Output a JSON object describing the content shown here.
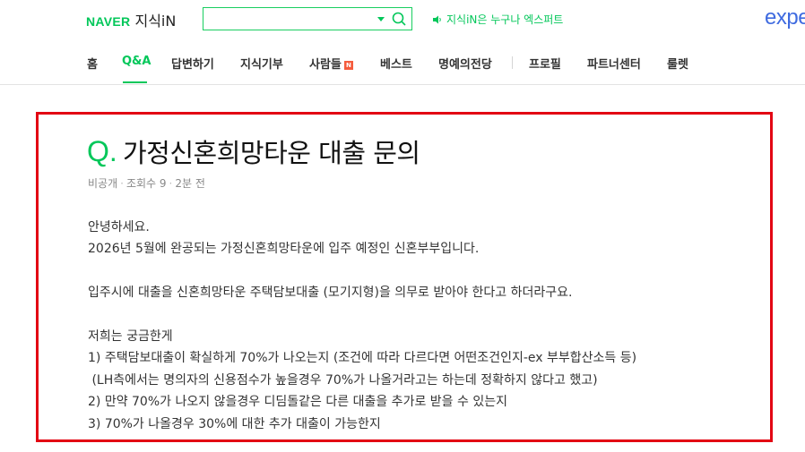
{
  "header": {
    "brand": "NAVER",
    "service": "지식iN",
    "search_value": "",
    "promo_text": "지식iN은 누구나 엑스퍼트",
    "expert_logo_text": "expe"
  },
  "nav": {
    "items": [
      {
        "label": "홈"
      },
      {
        "label": "Q&A"
      },
      {
        "label": "답변하기"
      },
      {
        "label": "지식기부"
      },
      {
        "label": "사람들"
      },
      {
        "label": "베스트"
      },
      {
        "label": "명예의전당"
      },
      {
        "label": "프로필"
      },
      {
        "label": "파트너센터"
      },
      {
        "label": "룰렛"
      }
    ],
    "active_index": 1,
    "badge_new": "N"
  },
  "question": {
    "q_mark": "Q.",
    "title": "가정신혼희망타운 대출 문의",
    "meta": {
      "author": "비공개",
      "views": "조회수 9",
      "time": "2분 전"
    },
    "body": [
      "안녕하세요.",
      "2026년 5월에 완공되는 가정신혼희망타운에 입주 예정인 신혼부부입니다.",
      "",
      "입주시에 대출을 신혼희망타운 주택담보대출 (모기지형)을 의무로 받아야 한다고 하더라구요.",
      "",
      "저희는 궁금한게",
      "1) 주택담보대출이 확실하게 70%가 나오는지 (조건에 따라 다르다면 어떤조건인지-ex 부부합산소득 등)",
      " (LH측에서는 명의자의 신용점수가 높을경우 70%가 나올거라고는 하는데 정확하지 않다고 했고)",
      "2) 만약 70%가 나오지 않을경우 디딤돌같은 다른 대출을 추가로 받을 수 있는지",
      "3) 70%가 나올경우 30%에 대한 추가 대출이 가능한지"
    ]
  },
  "colors": {
    "brand_green": "#03c75a",
    "highlight_red": "#e30613",
    "expert_blue": "#3f6be0"
  }
}
